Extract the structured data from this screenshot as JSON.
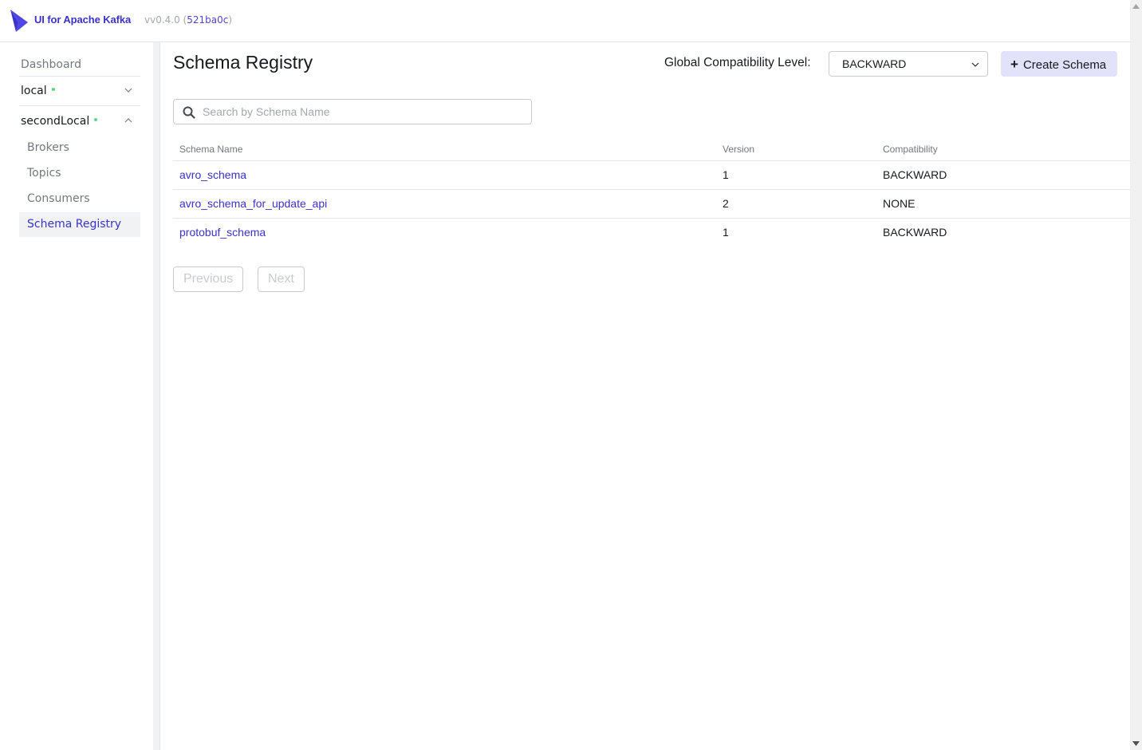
{
  "app": {
    "brand": "UI for Apache Kafka",
    "version_prefix": "vv0.4.0 (",
    "commit": "521ba0c",
    "version_suffix": ")"
  },
  "sidebar": {
    "dashboard": "Dashboard",
    "clusters": [
      {
        "name": "local",
        "status": "online",
        "expanded": false
      },
      {
        "name": "secondLocal",
        "status": "online",
        "expanded": true,
        "items": [
          "Brokers",
          "Topics",
          "Consumers",
          "Schema Registry"
        ],
        "active": "Schema Registry"
      }
    ]
  },
  "header": {
    "title": "Schema Registry",
    "compat_label": "Global Compatibility Level:",
    "compat_value": "BACKWARD",
    "create_label": "Create Schema"
  },
  "search": {
    "placeholder": "Search by Schema Name",
    "value": ""
  },
  "table": {
    "columns": [
      "Schema Name",
      "Version",
      "Compatibility"
    ],
    "rows": [
      {
        "name": "avro_schema",
        "version": "1",
        "compatibility": "BACKWARD"
      },
      {
        "name": "avro_schema_for_update_api",
        "version": "2",
        "compatibility": "NONE"
      },
      {
        "name": "protobuf_schema",
        "version": "1",
        "compatibility": "BACKWARD"
      }
    ]
  },
  "pagination": {
    "previous": "Previous",
    "next": "Next"
  },
  "colors": {
    "accent": "#3a32c9",
    "status_online": "#5cd685",
    "button_bg": "#e3e2fb"
  }
}
